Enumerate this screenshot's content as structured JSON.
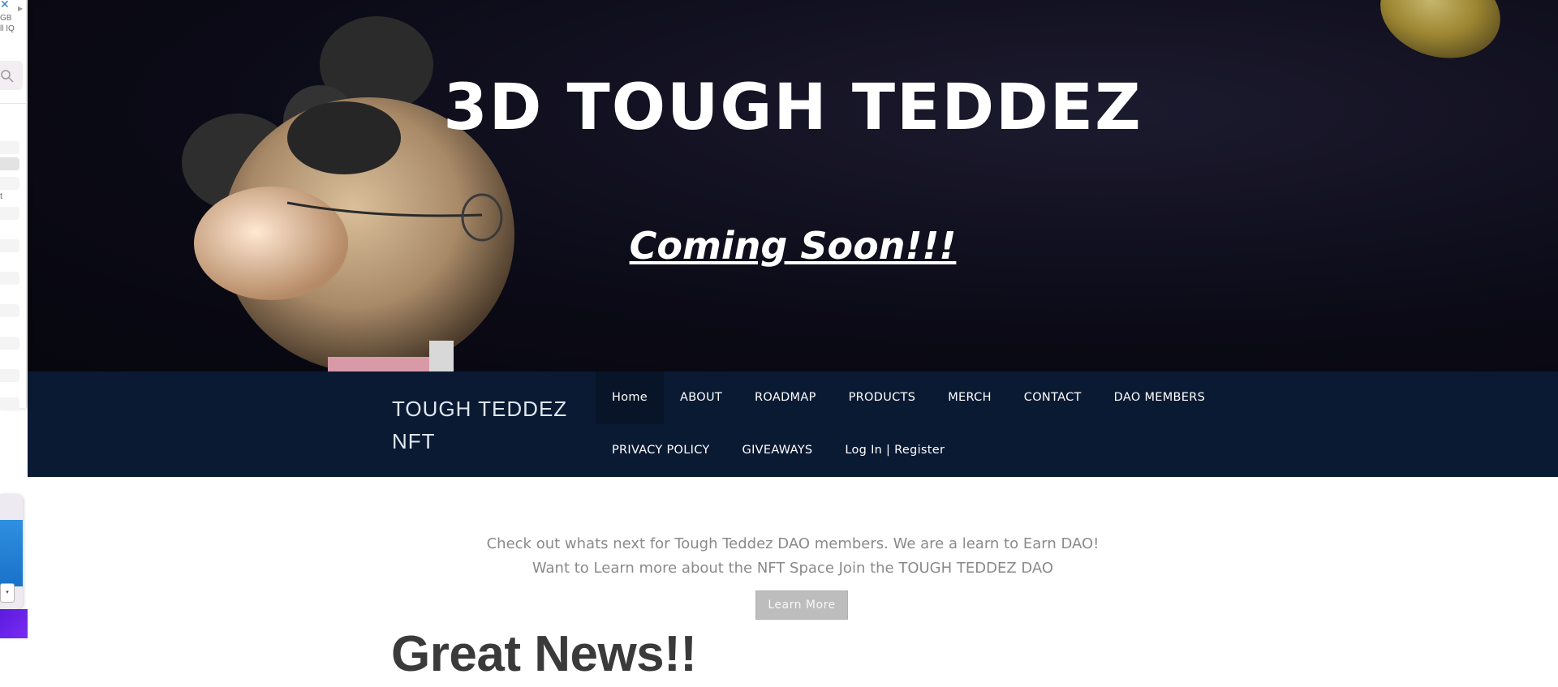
{
  "hero": {
    "title": "3D TOUGH TEDDEZ",
    "subtitle": "Coming Soon!!!"
  },
  "nav": {
    "brand_line1": "TOUGH TEDDEZ",
    "brand_line2": "NFT",
    "row1": [
      "Home",
      "ABOUT",
      "ROADMAP",
      "PRODUCTS",
      "MERCH",
      "CONTACT",
      "DAO MEMBERS"
    ],
    "row2": [
      "PRIVACY POLICY",
      "GIVEAWAYS",
      "Log In | Register"
    ],
    "active": "Home"
  },
  "content": {
    "line1": "Check out whats next for Tough Teddez DAO members. We are a learn to Earn DAO!",
    "line2": "Want to Learn more about the NFT Space Join the TOUGH TEDDEZ DAO",
    "button_label": "Learn More",
    "section_title": "Great News!!"
  },
  "left_panel": {
    "size_text_1": "GB",
    "size_text_2": "ll IQ",
    "row_text": "t"
  },
  "colors": {
    "nav_bg": "#0b1a33",
    "nav_active_bg": "#081428",
    "hero_bg": "#0b0a16",
    "button_bg": "#bdbdbd",
    "heading_text": "#3a3a3a",
    "body_text": "#8a8a8a"
  },
  "icons": [
    "close-icon",
    "play-arrow-icon",
    "search-icon",
    "dropdown-arrow-icon"
  ]
}
